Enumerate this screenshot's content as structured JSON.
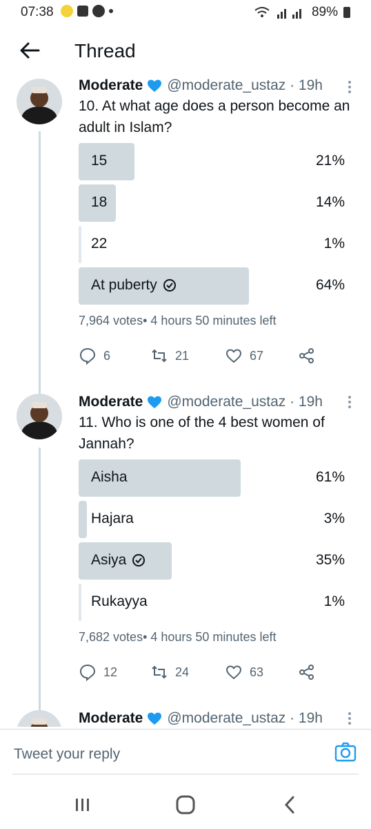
{
  "status_bar": {
    "time": "07:38",
    "battery": "89%"
  },
  "header": {
    "title": "Thread"
  },
  "tweets": [
    {
      "name": "Moderate",
      "handle": "@moderate_ustaz · 19h",
      "text": "10. At what age does a person become an adult in Islam?",
      "poll": [
        {
          "label": "15",
          "percent": "21%",
          "share": 21,
          "selected": false
        },
        {
          "label": "18",
          "percent": "14%",
          "share": 14,
          "selected": false
        },
        {
          "label": "22",
          "percent": "1%",
          "share": 1,
          "selected": false
        },
        {
          "label": "At puberty",
          "percent": "64%",
          "share": 64,
          "selected": true
        }
      ],
      "meta": "7,964 votes• 4 hours 50 minutes left",
      "replies": "6",
      "retweets": "21",
      "likes": "67"
    },
    {
      "name": "Moderate",
      "handle": "@moderate_ustaz · 19h",
      "text": "11. Who is one of the 4 best women of Jannah?",
      "poll": [
        {
          "label": "Aisha",
          "percent": "61%",
          "share": 61,
          "selected": false
        },
        {
          "label": "Hajara",
          "percent": "3%",
          "share": 3,
          "selected": false
        },
        {
          "label": "Asiya",
          "percent": "35%",
          "share": 35,
          "selected": true
        },
        {
          "label": "Rukayya",
          "percent": "1%",
          "share": 1,
          "selected": false
        }
      ],
      "meta": "7,682 votes• 4 hours 50 minutes left",
      "replies": "12",
      "retweets": "24",
      "likes": "63"
    },
    {
      "name": "Moderate",
      "handle": "@moderate_ustaz · 19h"
    }
  ],
  "reply_bar": {
    "placeholder": "Tweet your reply"
  },
  "colors": {
    "poll_fill": "#cfd9de",
    "verified": "#1d9bf0",
    "accent": "#1d9bf0",
    "muted": "#536471"
  }
}
